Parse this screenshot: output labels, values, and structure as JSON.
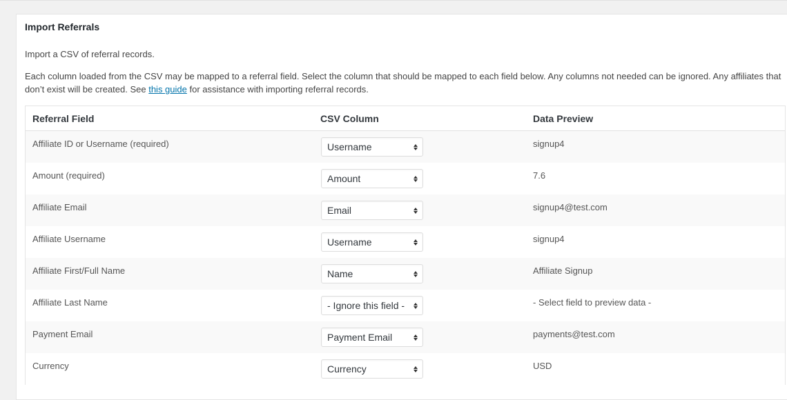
{
  "panel": {
    "title": "Import Referrals",
    "intro": "Import a CSV of referral records.",
    "description_before_link": "Each column loaded from the CSV may be mapped to a referral field. Select the column that should be mapped to each field below. Any columns not needed can be ignored. Any affiliates that don’t exist will be created. See ",
    "link_text": "this guide",
    "description_after_link": " for assistance with importing referral records.",
    "link_color": "#0073aa"
  },
  "table": {
    "headers": [
      "Referral Field",
      "CSV Column",
      "Data Preview"
    ],
    "rows": [
      {
        "field": "Affiliate ID or Username (required)",
        "column": "Username",
        "preview": "signup4"
      },
      {
        "field": "Amount (required)",
        "column": "Amount",
        "preview": "7.6"
      },
      {
        "field": "Affiliate Email",
        "column": "Email",
        "preview": "signup4@test.com"
      },
      {
        "field": "Affiliate Username",
        "column": "Username",
        "preview": "signup4"
      },
      {
        "field": "Affiliate First/Full Name",
        "column": "Name",
        "preview": "Affiliate Signup"
      },
      {
        "field": "Affiliate Last Name",
        "column": "- Ignore this field -",
        "preview": "- Select field to preview data -"
      },
      {
        "field": "Payment Email",
        "column": "Payment Email",
        "preview": "payments@test.com"
      },
      {
        "field": "Currency",
        "column": "Currency",
        "preview": "USD"
      }
    ]
  },
  "icons": {
    "select_arrows": "up-down-chevron-icon"
  }
}
